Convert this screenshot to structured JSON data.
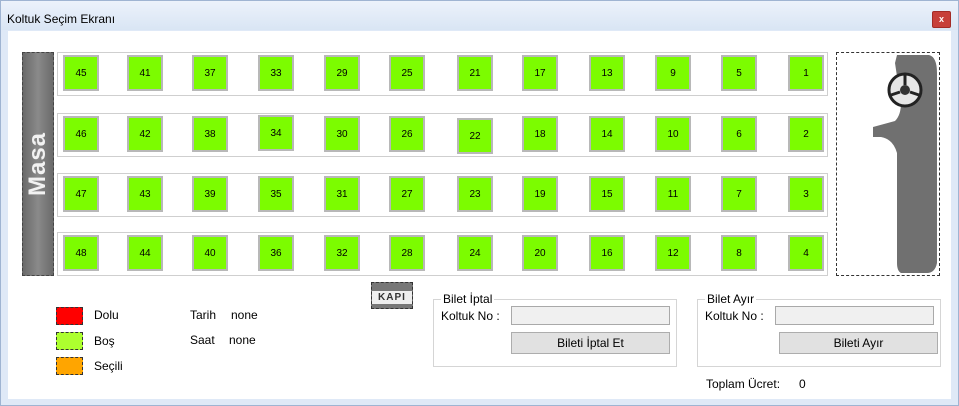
{
  "window": {
    "title": "Koltuk Seçim Ekranı",
    "close_label": "x"
  },
  "masa_label": "Masa",
  "door_label": "KAPI",
  "seat_color": "#7cfc00",
  "seats": [
    [
      "45",
      "41",
      "37",
      "33",
      "29",
      "25",
      "21",
      "17",
      "13",
      "9",
      "5",
      "1"
    ],
    [
      "46",
      "42",
      "38",
      "34",
      "30",
      "26",
      "22",
      "18",
      "14",
      "10",
      "6",
      "2"
    ],
    [
      "47",
      "43",
      "39",
      "35",
      "31",
      "27",
      "23",
      "19",
      "15",
      "11",
      "7",
      "3"
    ],
    [
      "48",
      "44",
      "40",
      "36",
      "32",
      "28",
      "24",
      "20",
      "16",
      "12",
      "8",
      "4"
    ]
  ],
  "legend": [
    {
      "label": "Dolu",
      "color": "#ff0000"
    },
    {
      "label": "Boş",
      "color": "#adff2f"
    },
    {
      "label": "Seçili",
      "color": "#ffa500"
    }
  ],
  "info": {
    "tarih_label": "Tarih",
    "tarih_value": "none",
    "saat_label": "Saat",
    "saat_value": "none"
  },
  "cancel_group": {
    "title": "Bilet İptal",
    "seat_label": "Koltuk No :",
    "seat_value": "",
    "button": "Bileti İptal Et"
  },
  "split_group": {
    "title": "Bilet Ayır",
    "seat_label": "Koltuk No :",
    "seat_value": "",
    "button": "Bileti Ayır"
  },
  "total": {
    "label": "Toplam Ücret:",
    "value": "0"
  }
}
